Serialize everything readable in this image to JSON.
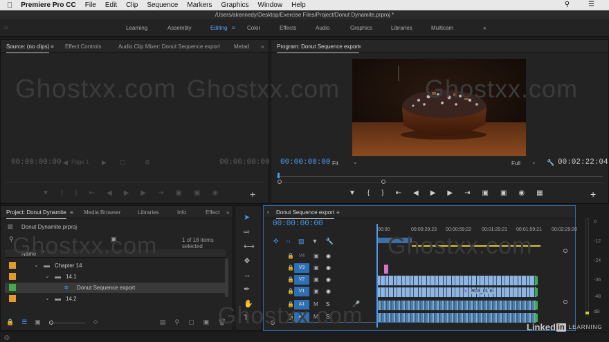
{
  "menubar": {
    "apple": "",
    "app": "Premiere Pro CC",
    "items": [
      "File",
      "Edit",
      "Clip",
      "Sequence",
      "Markers",
      "Graphics",
      "Window",
      "Help"
    ]
  },
  "title": "/Users/akennedy/Desktop/Exercise Files/Project/Donut Dynamite.prproj *",
  "workspaces": [
    "Learning",
    "Assembly",
    "Editing",
    "Color",
    "Effects",
    "Audio",
    "Graphics",
    "Libraries",
    "Multicam"
  ],
  "source": {
    "tabs": [
      "Source: (no clips)",
      "Effect Controls",
      "Audio Clip Mixer: Donut Sequence export",
      "Metad"
    ],
    "timecode_in": "00:00:00:00",
    "page": "Page 1",
    "timecode_out": "00:00:00:00"
  },
  "program": {
    "tab": "Program: Donut Sequence export",
    "timecode": "00:00:00:00",
    "fit": "Fit",
    "quality": "Full",
    "duration": "00:02:22:04"
  },
  "project": {
    "tabs": [
      "Project: Donut Dynamite",
      "Media Browser",
      "Libraries",
      "Info",
      "Effect"
    ],
    "file": "Donut Dynamite.prproj",
    "count": "1 of 18 items selected",
    "col_name": "Name",
    "items": [
      {
        "label": "Chapter 14",
        "color": "#e39a2b",
        "indent": 0
      },
      {
        "label": "14.1",
        "color": "#e39a2b",
        "indent": 1
      },
      {
        "label": "Donut Sequence export",
        "color": "#3fae49",
        "indent": 2
      },
      {
        "label": "14.2",
        "color": "#e39a2b",
        "indent": 1
      }
    ]
  },
  "timeline": {
    "tab": "Donut Sequence export",
    "timecode": "00:00:00:00",
    "ruler": [
      ":00:00",
      "00:00:29:23",
      "00:00:59:22",
      "00:01:29:21",
      "00:01:59:21",
      "00:02:29:20"
    ],
    "tracks_video": [
      "V4",
      "V3",
      "V2",
      "V1"
    ],
    "tracks_audio": [
      "A1",
      "A2"
    ],
    "clip_label": "R03_01 In",
    "solo": "S",
    "mute": "M"
  },
  "meter": [
    "0",
    "-12",
    "-24",
    "-36",
    "-48",
    "dB"
  ],
  "watermark": "Ghostxx.com",
  "brand": "Linked",
  "brand_in": "in",
  "brand_learning": "LEARNING"
}
